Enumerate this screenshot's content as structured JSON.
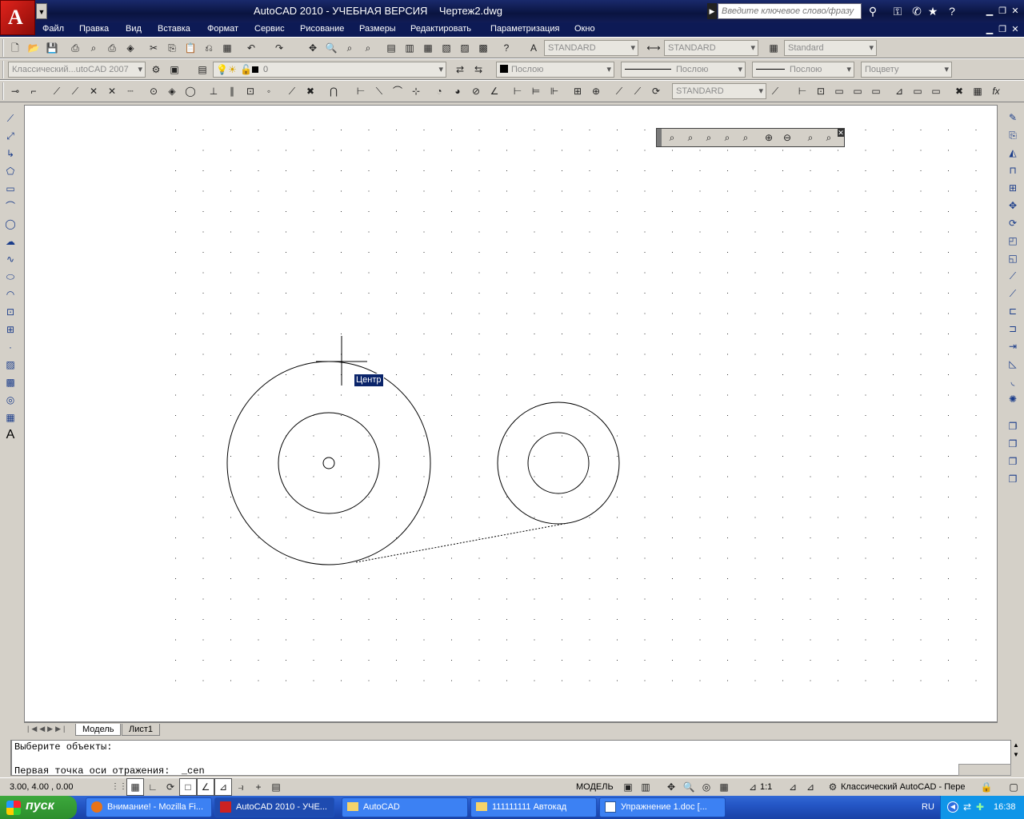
{
  "title": "AutoCAD 2010 - УЧЕБНАЯ ВЕРСИЯ    Чертеж2.dwg",
  "search": {
    "placeholder": "Введите ключевое слово/фразу"
  },
  "menu": [
    "Файл",
    "Правка",
    "Вид",
    "Вставка",
    "Формат",
    "Сервис",
    "Рисование",
    "Размеры",
    "Редактировать",
    "Параметризация",
    "Окно"
  ],
  "styles": {
    "text_style": "STANDARD",
    "dim_style": "STANDARD",
    "table_style": "Standard",
    "mleader_style": "STANDARD"
  },
  "workspace": {
    "combo": "Классический...utoCAD 2007"
  },
  "layer": {
    "current": "0"
  },
  "properties": {
    "color": "Послою",
    "linetype": "Послою",
    "lineweight": "Послою",
    "plotstyle": "Поцвету"
  },
  "tooltip": "Центр",
  "tabs": {
    "model": "Модель",
    "layout1": "Лист1"
  },
  "command": {
    "line1": "Выберите объекты:",
    "line2": "Первая точка оси отражения:  _cen"
  },
  "status": {
    "coords": "3.00, 4.00 , 0.00",
    "model": "МОДЕЛЬ",
    "scale": "1:1",
    "workspace": "Классический AutoCAD - Пере"
  },
  "taskbar": {
    "start": "пуск",
    "tasks": [
      "Внимание! - Mozilla Fi...",
      "AutoCAD 2010 - УЧЕ...",
      "AutoCAD",
      "111111111 Автокад",
      "Упражнение 1.doc [..."
    ],
    "lang": "RU",
    "time": "16:38"
  },
  "colors": {
    "menubar": "#0d1a55",
    "canvas": "#ffffff",
    "taskbar": "#2456c5",
    "start": "#2d8e2d",
    "tooltip_bg": "#0a246a"
  }
}
